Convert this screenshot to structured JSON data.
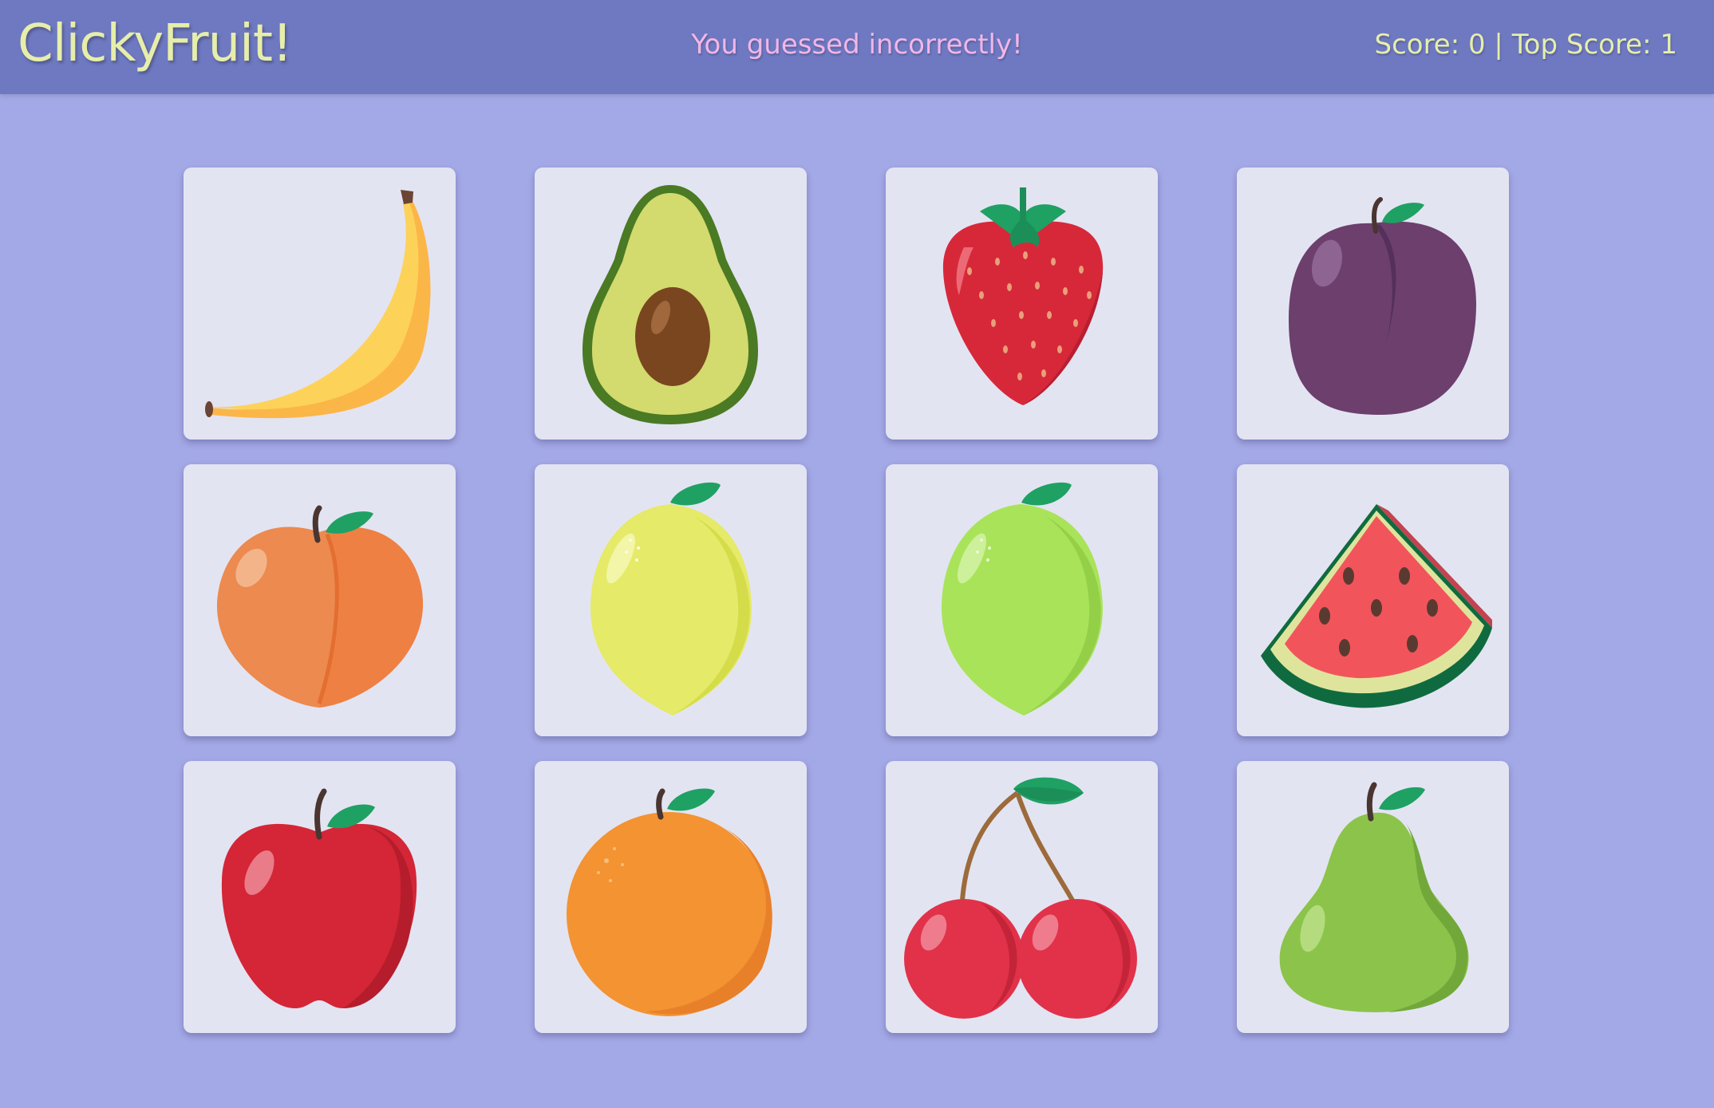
{
  "header": {
    "brand": "ClickyFruit!",
    "message": "You guessed incorrectly!",
    "score_text": "Score: 0 | Top Score: 1"
  },
  "cards": [
    {
      "fruit": "banana",
      "icon": "banana-icon"
    },
    {
      "fruit": "avocado",
      "icon": "avocado-icon"
    },
    {
      "fruit": "strawberry",
      "icon": "strawberry-icon"
    },
    {
      "fruit": "plum",
      "icon": "plum-icon"
    },
    {
      "fruit": "peach",
      "icon": "peach-icon"
    },
    {
      "fruit": "lemon",
      "icon": "lemon-icon"
    },
    {
      "fruit": "lime",
      "icon": "lime-icon"
    },
    {
      "fruit": "watermelon",
      "icon": "watermelon-icon"
    },
    {
      "fruit": "apple",
      "icon": "apple-icon"
    },
    {
      "fruit": "orange",
      "icon": "orange-icon"
    },
    {
      "fruit": "cherry",
      "icon": "cherry-icon"
    },
    {
      "fruit": "pear",
      "icon": "pear-icon"
    }
  ],
  "colors": {
    "page_bg": "#a3a8e6",
    "navbar_bg": "#6e79c2",
    "brand_text": "#e6eeaa",
    "message_text": "#f2b6e6",
    "card_bg": "#e3e4f2"
  }
}
